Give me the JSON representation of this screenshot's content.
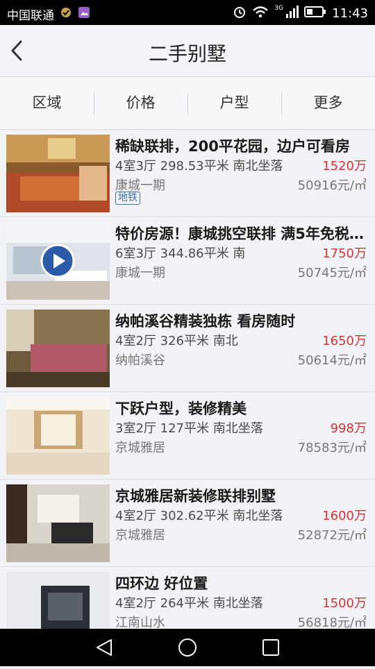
{
  "status_bar": {
    "carrier": "中国联通",
    "network": "3G",
    "time": "11:43"
  },
  "header": {
    "title": "二手别墅"
  },
  "filters": [
    "区域",
    "价格",
    "户型",
    "更多"
  ],
  "listings": [
    {
      "title": "稀缺联排，200平花园，边户可看房",
      "meta": "4室3厅 298.53平米 南北坐落",
      "price": "1520万",
      "area": "康城一期",
      "unit_price": "50916元/㎡",
      "tag": "地铁"
    },
    {
      "title": "特价房源！康城挑空联排 满5年免税…",
      "meta": "6室3厅 344.86平米 南",
      "price": "1750万",
      "area": "康城一期",
      "unit_price": "50745元/㎡"
    },
    {
      "title": "纳帕溪谷精装独栋 看房随时",
      "meta": "4室2厅 326平米 南北",
      "price": "1650万",
      "area": "纳帕溪谷",
      "unit_price": "50614元/㎡"
    },
    {
      "title": "下跃户型，装修精美",
      "meta": "3室2厅 127平米 南北坐落",
      "price": "998万",
      "area": "京城雅居",
      "unit_price": "78583元/㎡"
    },
    {
      "title": "京城雅居新装修联排别墅",
      "meta": "4室2厅 302.62平米 南北坐落",
      "price": "1600万",
      "area": "京城雅居",
      "unit_price": "52872元/㎡"
    },
    {
      "title": "四环边 好位置",
      "meta": "4室2厅 264平米 南北坐落",
      "price": "1500万",
      "area": "江南山水",
      "unit_price": "56818元/㎡"
    }
  ],
  "colors": {
    "price": "#d63333",
    "tag": "#3a6fb0"
  }
}
